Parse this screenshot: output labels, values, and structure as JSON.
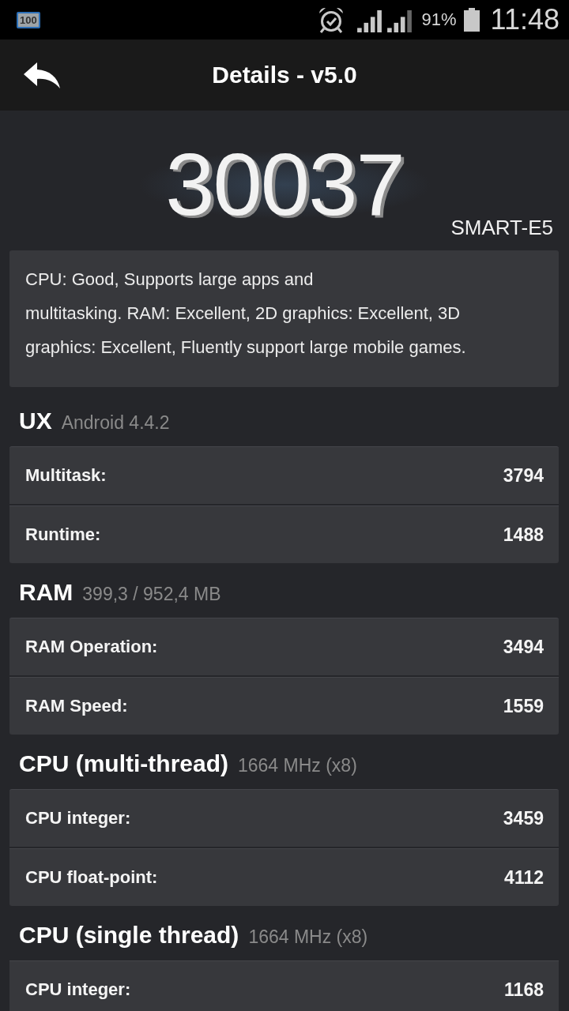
{
  "status_bar": {
    "notification": "100",
    "battery_percent": "91%",
    "time": "11:48"
  },
  "app_bar": {
    "title": "Details - v5.0"
  },
  "score": {
    "value": "30037",
    "device": "SMART-E5"
  },
  "summary": {
    "lines": [
      "CPU: Good, Supports large apps and",
      "multitasking. RAM: Excellent, 2D graphics: Excellent, 3D",
      "graphics: Excellent, Fluently support large mobile games."
    ]
  },
  "sections": [
    {
      "title": "UX",
      "subtitle": "Android 4.4.2",
      "rows": [
        {
          "label": "Multitask:",
          "value": "3794"
        },
        {
          "label": "Runtime:",
          "value": "1488"
        }
      ]
    },
    {
      "title": "RAM",
      "subtitle": "399,3 / 952,4 MB",
      "rows": [
        {
          "label": "RAM Operation:",
          "value": "3494"
        },
        {
          "label": "RAM Speed:",
          "value": "1559"
        }
      ]
    },
    {
      "title": "CPU (multi-thread)",
      "subtitle": "1664 MHz (x8)",
      "rows": [
        {
          "label": "CPU integer:",
          "value": "3459"
        },
        {
          "label": "CPU float-point:",
          "value": "4112"
        }
      ]
    },
    {
      "title": "CPU (single thread)",
      "subtitle": "1664 MHz (x8)",
      "rows": [
        {
          "label": "CPU integer:",
          "value": "1168"
        }
      ]
    }
  ]
}
